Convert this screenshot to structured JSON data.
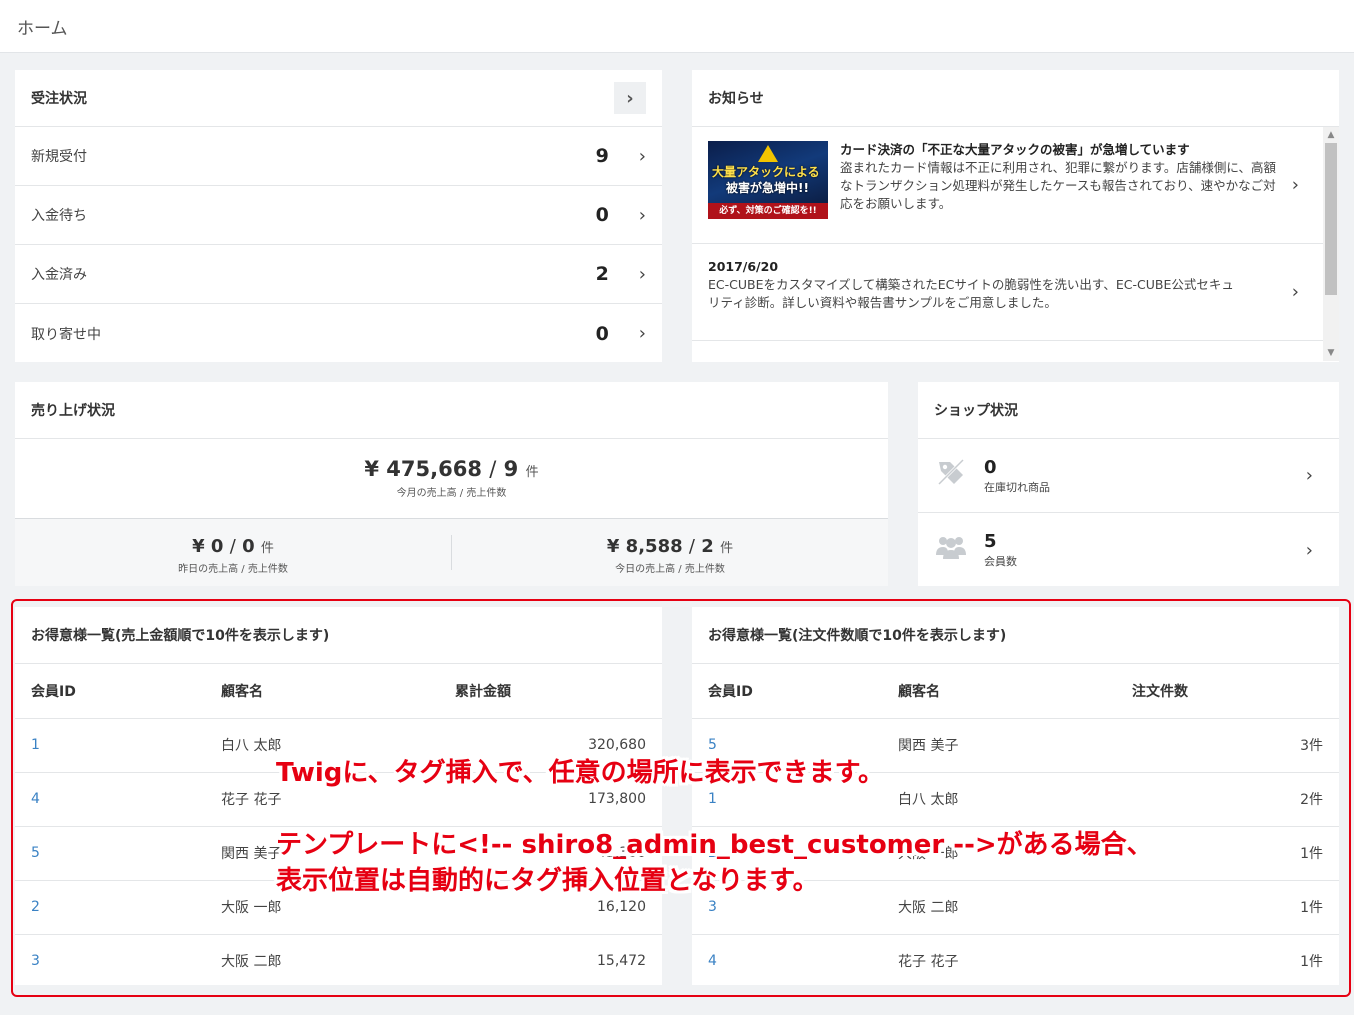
{
  "page_title": "ホーム",
  "order_status": {
    "title": "受注状況",
    "rows": [
      {
        "label": "新規受付",
        "count": "9"
      },
      {
        "label": "入金待ち",
        "count": "0"
      },
      {
        "label": "入金済み",
        "count": "2"
      },
      {
        "label": "取り寄せ中",
        "count": "0"
      }
    ]
  },
  "news": {
    "title": "お知らせ",
    "items": [
      {
        "thumb_lines": [
          "大量アタックによる",
          "被害が急増中!!",
          "必ず、対策のご確認を!!"
        ],
        "title": "カード決済の「不正な大量アタックの被害」が急増しています",
        "body": "盗まれたカード情報は不正に利用され、犯罪に繋がります。店舗様側に、高額なトランザクション処理料が発生したケースも報告されており、速やかなご対応をお願いします。"
      },
      {
        "date": "2017/6/20",
        "body": "EC-CUBEをカスタマイズして構築されたECサイトの脆弱性を洗い出す、EC-CUBE公式セキュリティ診断。詳しい資料や報告書サンプルをご用意しました。"
      }
    ]
  },
  "sales": {
    "title": "売り上げ状況",
    "month": {
      "amount": "¥ 475,668",
      "sep": "/",
      "count": "9",
      "unit": "件",
      "caption": "今月の売上高 / 売上件数"
    },
    "yesterday": {
      "amount": "¥ 0",
      "sep": "/",
      "count": "0",
      "unit": "件",
      "caption": "昨日の売上高 / 売上件数"
    },
    "today": {
      "amount": "¥ 8,588",
      "sep": "/",
      "count": "2",
      "unit": "件",
      "caption": "今日の売上高 / 売上件数"
    }
  },
  "shop": {
    "title": "ショップ状況",
    "rows": [
      {
        "icon": "tag-slash-icon",
        "value": "0",
        "caption": "在庫切れ商品"
      },
      {
        "icon": "users-icon",
        "value": "5",
        "caption": "会員数"
      }
    ]
  },
  "best_by_amount": {
    "title": "お得意様一覧(売上金額順で10件を表示します)",
    "headers": [
      "会員ID",
      "顧客名",
      "累計金額"
    ],
    "rows": [
      [
        "1",
        "白八 太郎",
        "320,680"
      ],
      [
        "4",
        "花子 花子",
        "173,800"
      ],
      [
        "5",
        "関西 美子",
        "45,300"
      ],
      [
        "2",
        "大阪 一郎",
        "16,120"
      ],
      [
        "3",
        "大阪 二郎",
        "15,472"
      ]
    ]
  },
  "best_by_count": {
    "title": "お得意様一覧(注文件数順で10件を表示します)",
    "headers": [
      "会員ID",
      "顧客名",
      "注文件数"
    ],
    "rows": [
      [
        "5",
        "関西 美子",
        "3件"
      ],
      [
        "1",
        "白八 太郎",
        "2件"
      ],
      [
        "2",
        "大阪 一郎",
        "1件"
      ],
      [
        "3",
        "大阪 二郎",
        "1件"
      ],
      [
        "4",
        "花子 花子",
        "1件"
      ]
    ]
  },
  "annotation": {
    "line1": "Twigに、タグ挿入で、任意の場所に表示できます。",
    "line2": "テンプレートに<!-- shiro8_admin_best_customer -->がある場合、",
    "line3": "表示位置は自動的にタグ挿入位置となります。",
    "color": "#e60012"
  }
}
